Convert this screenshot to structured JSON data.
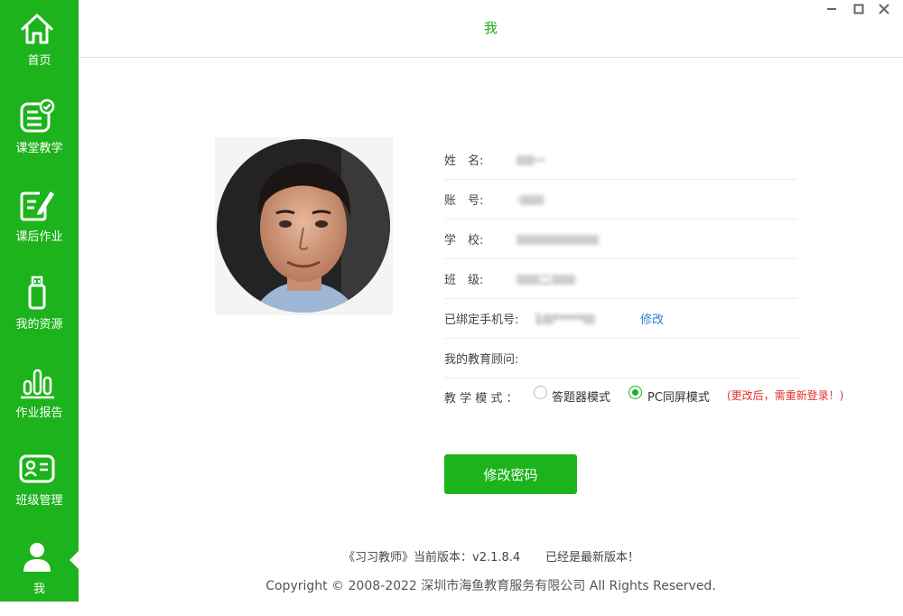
{
  "sidebar": {
    "accent": "#1db31c",
    "items": [
      {
        "label": "首页",
        "icon": "home-icon"
      },
      {
        "label": "课堂教学",
        "icon": "classroom-checklist-icon"
      },
      {
        "label": "课后作业",
        "icon": "homework-edit-icon"
      },
      {
        "label": "我的资源",
        "icon": "usb-drive-icon"
      },
      {
        "label": "作业报告",
        "icon": "bar-chart-icon"
      },
      {
        "label": "班级管理",
        "icon": "id-card-icon"
      },
      {
        "label": "我",
        "icon": "user-icon",
        "active": true
      }
    ]
  },
  "header": {
    "title": "我"
  },
  "window_controls": {
    "minimize": "minimize-icon",
    "maximize": "maximize-icon",
    "close": "close-icon"
  },
  "profile": {
    "avatar": "profile-photo",
    "fields": [
      {
        "label": "姓　名:",
        "value": "ﾛﾛﾛ一"
      },
      {
        "label": "账　号:",
        "value": "·ﾛﾛﾛﾛ"
      },
      {
        "label": "学　校:",
        "value": "ﾛﾛﾛﾛﾛﾛﾛﾛﾛﾛﾛﾛﾛﾛ"
      },
      {
        "label": "班　级:",
        "value": "ﾛﾛﾛﾛ二ﾛﾛﾛﾛ"
      }
    ],
    "phone": {
      "label": "已绑定手机号:",
      "value": "1ﾛﾛ*****ﾛﾛ",
      "edit_label": "修改"
    },
    "advisor": {
      "label": "我的教育顾问:"
    },
    "teaching_mode": {
      "label": "教 学 模 式 ：",
      "options": [
        {
          "label": "答题器模式",
          "selected": false
        },
        {
          "label": "PC同屏模式",
          "selected": true
        }
      ],
      "warning": "(更改后，需重新登录！)"
    }
  },
  "change_password_button": "修改密码",
  "footer": {
    "version": "《习习教师》当前版本：v2.1.8.4",
    "latest": "已经是最新版本！",
    "copyright": "Copyright © 2008-2022 深圳市海鱼教育服务有限公司 All Rights Reserved."
  }
}
